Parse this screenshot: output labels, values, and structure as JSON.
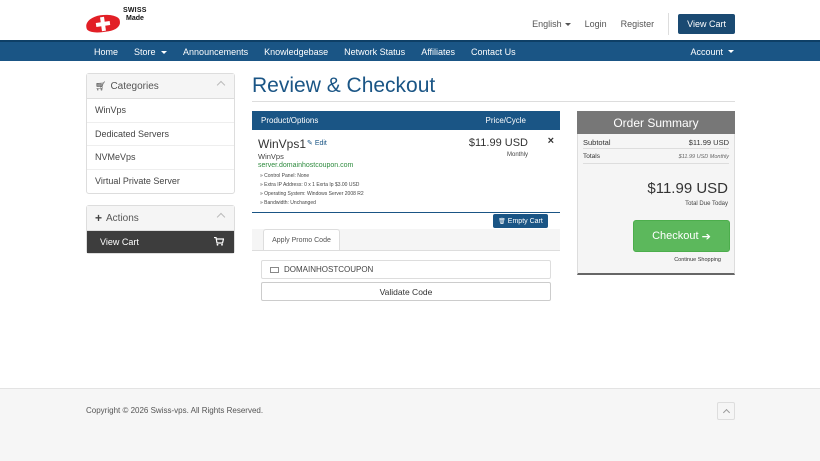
{
  "logo": {
    "line1": "SWISS",
    "line2": "Made"
  },
  "header": {
    "language": "English",
    "login": "Login",
    "register": "Register",
    "view_cart": "View Cart"
  },
  "nav": {
    "items": [
      "Home",
      "Store",
      "Announcements",
      "Knowledgebase",
      "Network Status",
      "Affiliates",
      "Contact Us"
    ],
    "account": "Account"
  },
  "sidebar": {
    "categories_title": "Categories",
    "categories": [
      "WinVps",
      "Dedicated Servers",
      "NVMeVps",
      "Virtual Private Server"
    ],
    "actions_title": "Actions",
    "view_cart": "View Cart"
  },
  "main": {
    "title": "Review & Checkout",
    "table_headers": {
      "product": "Product/Options",
      "price": "Price/Cycle"
    },
    "item": {
      "name": "WinVps1",
      "edit": "Edit",
      "group": "WinVps",
      "domain": "server.domainhostcoupon.com",
      "details": [
        "» Control Panel: None",
        "» Extra IP Address: 0 x 1 Exrta Ip $3.00 USD",
        "» Operating System: Windows Server 2008 R2",
        "» Bandwidth: Unchanged"
      ],
      "price": "$11.99 USD",
      "cycle": "Monthly",
      "remove": "×"
    },
    "empty_cart": "Empty Cart",
    "promo": {
      "tab": "Apply Promo Code",
      "input_value": "DOMAINHOSTCOUPON",
      "validate": "Validate Code"
    }
  },
  "summary": {
    "title": "Order Summary",
    "subtotal_label": "Subtotal",
    "subtotal_value": "$11.99 USD",
    "totals_label": "Totals",
    "totals_value": "$11.99 USD Monthly",
    "total_big": "$11.99 USD",
    "total_due": "Total Due Today",
    "checkout": "Checkout",
    "continue": "Continue Shopping"
  },
  "footer": {
    "copyright": "Copyright © 2026 Swiss-vps. All Rights Reserved."
  },
  "colors": {
    "primary": "#1a5585",
    "success": "#5cb85c",
    "summary_head": "#777777"
  }
}
